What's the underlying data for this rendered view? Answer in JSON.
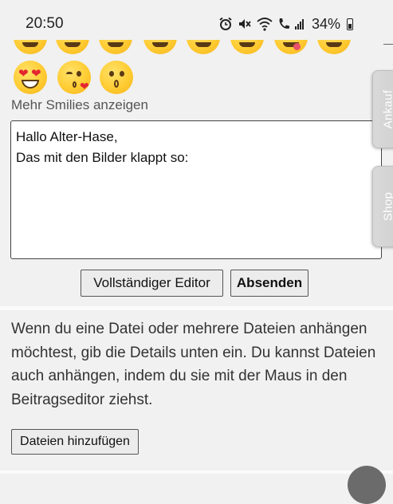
{
  "status_bar": {
    "time": "20:50",
    "battery_percent": "34%",
    "icons": [
      "alarm-icon",
      "mute-icon",
      "wifi-icon",
      "call-icon",
      "signal-icon",
      "battery-icon"
    ]
  },
  "smilies": {
    "rows": [
      [
        "smile",
        "smile",
        "smile",
        "smile",
        "smile",
        "smile",
        "wink-tongue",
        "smile"
      ],
      [
        "heart-eyes",
        "kissing-heart",
        "kissing"
      ]
    ],
    "more_link": "Mehr Smilies anzeigen"
  },
  "editor": {
    "line1": "Hallo Alter-Hase,",
    "line2": "Das mit den Bilder klappt so:"
  },
  "buttons": {
    "full_editor": "Vollständiger Editor",
    "submit": "Absenden",
    "add_files": "Dateien hinzufügen"
  },
  "attachments": {
    "info": "Wenn du eine Datei oder mehrere Dateien anhängen möchtest, gib die Details unten ein. Du kannst Dateien auch anhängen, indem du sie mit der Maus in den Beitragseditor ziehst."
  },
  "side_tabs": {
    "ankauf": "Ankauf",
    "shop": "Shop"
  },
  "colors": {
    "emoji_yellow": "#ffcc33",
    "heart_red": "#e3262f",
    "side_tab_bg": "#d4d4d4"
  }
}
